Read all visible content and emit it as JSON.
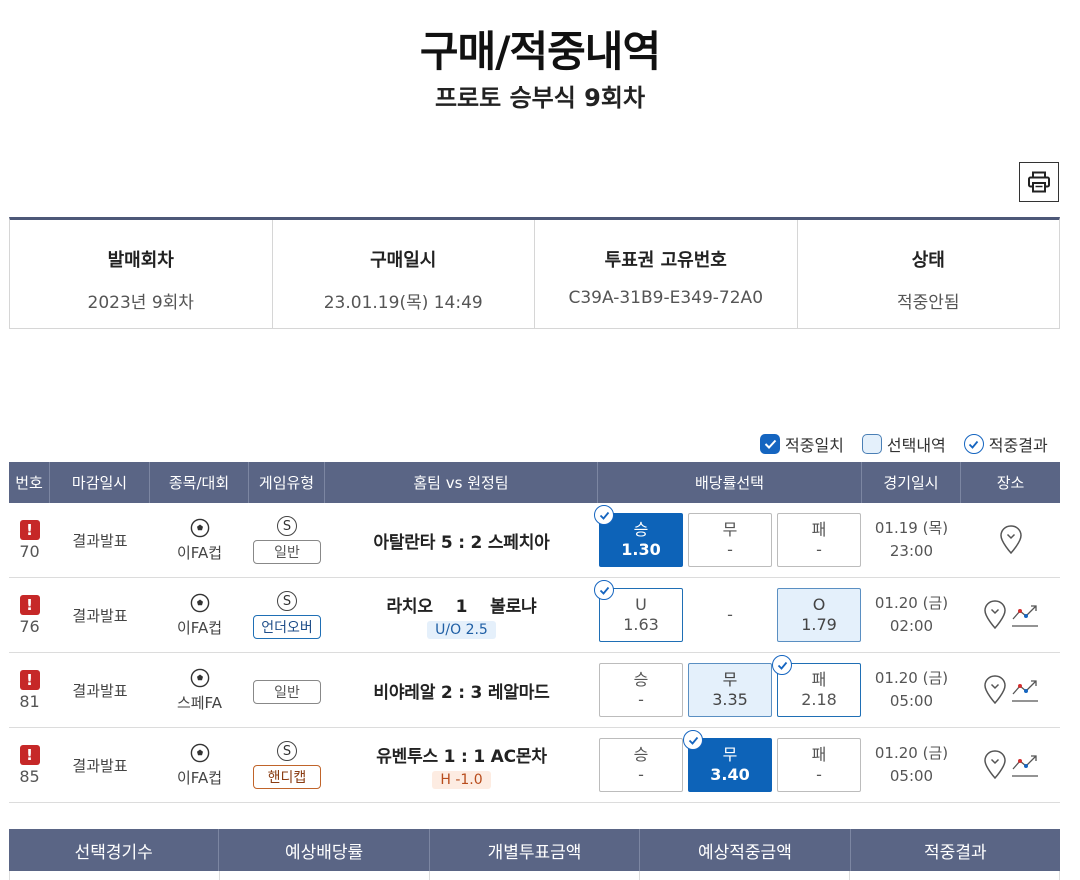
{
  "page": {
    "title": "구매/적중내역",
    "subtitle": "프로토 승부식 9회차"
  },
  "info": {
    "headers": [
      "발매회차",
      "구매일시",
      "투표권 고유번호",
      "상태"
    ],
    "values": [
      "2023년 9회차",
      "23.01.19(목) 14:49",
      "C39A-31B9-E349-72A0",
      "적중안됨"
    ]
  },
  "legend": {
    "match": "적중일치",
    "selected": "선택내역",
    "result": "적중결과"
  },
  "table": {
    "headers": [
      "번호",
      "마감일시",
      "종목/대회",
      "게임유형",
      "홈팀 vs 원정팀",
      "배당률선택",
      "경기일시",
      "장소"
    ],
    "rows": [
      {
        "no": "70",
        "close": "결과발표",
        "league": "이FA컵",
        "s_mark": "S",
        "game_type": "일반",
        "teams": "아탈란타 5 : 2 스페치아",
        "sub": "",
        "odds": [
          {
            "label": "승",
            "value": "1.30"
          },
          {
            "label": "무",
            "value": "-"
          },
          {
            "label": "패",
            "value": "-"
          }
        ],
        "date": "01.19 (목)",
        "time": "23:00"
      },
      {
        "no": "76",
        "close": "결과발표",
        "league": "이FA컵",
        "s_mark": "S",
        "game_type": "언더오버",
        "teams": "라치오    1    볼로냐",
        "sub": "U/O 2.5",
        "odds": [
          {
            "label": "U",
            "value": "1.63"
          },
          {
            "label": "",
            "value": "-"
          },
          {
            "label": "O",
            "value": "1.79"
          }
        ],
        "date": "01.20 (금)",
        "time": "02:00"
      },
      {
        "no": "81",
        "close": "결과발표",
        "league": "스페FA",
        "s_mark": "",
        "game_type": "일반",
        "teams": "비야레알 2 : 3 레알마드",
        "sub": "",
        "odds": [
          {
            "label": "승",
            "value": "-"
          },
          {
            "label": "무",
            "value": "3.35"
          },
          {
            "label": "패",
            "value": "2.18"
          }
        ],
        "date": "01.20 (금)",
        "time": "05:00"
      },
      {
        "no": "85",
        "close": "결과발표",
        "league": "이FA컵",
        "s_mark": "S",
        "game_type": "핸디캡",
        "teams": "유벤투스 1 : 1 AC몬차",
        "sub": "H -1.0",
        "odds": [
          {
            "label": "승",
            "value": "-"
          },
          {
            "label": "무",
            "value": "3.40"
          },
          {
            "label": "패",
            "value": "-"
          }
        ],
        "date": "01.20 (금)",
        "time": "05:00"
      }
    ]
  },
  "summary": {
    "headers": [
      "선택경기수",
      "예상배당률",
      "개별투표금액",
      "예상적중금액",
      "적중결과"
    ]
  },
  "colors": {
    "header_bg": "#5a6585",
    "selected_blue": "#0d63b8",
    "highlight_light": "#e4f0fb",
    "warning_red": "#c62828"
  }
}
